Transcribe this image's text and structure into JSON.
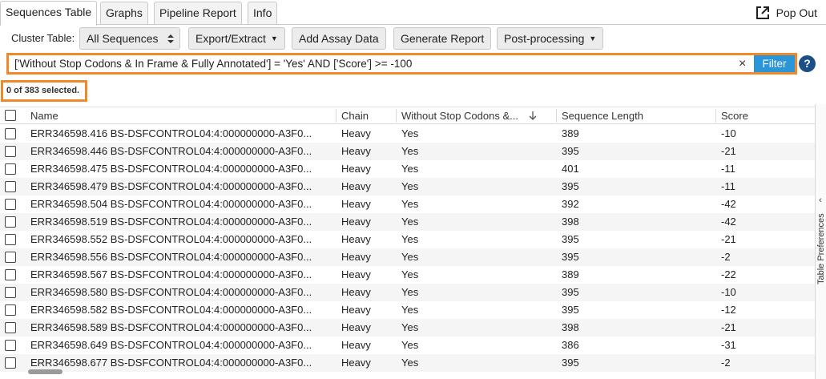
{
  "tabs": [
    {
      "label": "Sequences Table",
      "active": true
    },
    {
      "label": "Graphs",
      "active": false
    },
    {
      "label": "Pipeline Report",
      "active": false
    },
    {
      "label": "Info",
      "active": false
    }
  ],
  "popout": {
    "label": "Pop Out",
    "icon": "external-link-icon"
  },
  "toolbar": {
    "cluster_table_label": "Cluster Table:",
    "cluster_table_value": "All Sequences",
    "export_label": "Export/Extract",
    "add_assay_label": "Add Assay Data",
    "generate_report_label": "Generate Report",
    "post_processing_label": "Post-processing"
  },
  "filter": {
    "query": "['Without Stop Codons & In Frame & Fully Annotated'] = 'Yes' AND ['Score'] >= -100",
    "clear_icon": "×",
    "button_label": "Filter",
    "help_icon": "?"
  },
  "selection": {
    "text": "0 of 383 selected."
  },
  "colors": {
    "accent_blue": "#2a95d8",
    "highlight_orange": "#f0892c",
    "help_navy": "#1c4f86"
  },
  "table": {
    "columns": [
      "Name",
      "Chain",
      "Without Stop Codons &...",
      "Sequence Length",
      "Score"
    ],
    "sorted_column": "Without Stop Codons &...",
    "sort_direction": "descending",
    "rows": [
      {
        "name": "ERR346598.416 BS-DSFCONTROL04:4:000000000-A3F0...",
        "chain": "Heavy",
        "wsc": "Yes",
        "length": "389",
        "score": "-10"
      },
      {
        "name": "ERR346598.446 BS-DSFCONTROL04:4:000000000-A3F0...",
        "chain": "Heavy",
        "wsc": "Yes",
        "length": "395",
        "score": "-21"
      },
      {
        "name": "ERR346598.475 BS-DSFCONTROL04:4:000000000-A3F0...",
        "chain": "Heavy",
        "wsc": "Yes",
        "length": "401",
        "score": "-11"
      },
      {
        "name": "ERR346598.479 BS-DSFCONTROL04:4:000000000-A3F0...",
        "chain": "Heavy",
        "wsc": "Yes",
        "length": "395",
        "score": "-11"
      },
      {
        "name": "ERR346598.504 BS-DSFCONTROL04:4:000000000-A3F0...",
        "chain": "Heavy",
        "wsc": "Yes",
        "length": "392",
        "score": "-42"
      },
      {
        "name": "ERR346598.519 BS-DSFCONTROL04:4:000000000-A3F0...",
        "chain": "Heavy",
        "wsc": "Yes",
        "length": "398",
        "score": "-42"
      },
      {
        "name": "ERR346598.552 BS-DSFCONTROL04:4:000000000-A3F0...",
        "chain": "Heavy",
        "wsc": "Yes",
        "length": "395",
        "score": "-21"
      },
      {
        "name": "ERR346598.556 BS-DSFCONTROL04:4:000000000-A3F0...",
        "chain": "Heavy",
        "wsc": "Yes",
        "length": "395",
        "score": "-2"
      },
      {
        "name": "ERR346598.567 BS-DSFCONTROL04:4:000000000-A3F0...",
        "chain": "Heavy",
        "wsc": "Yes",
        "length": "389",
        "score": "-22"
      },
      {
        "name": "ERR346598.580 BS-DSFCONTROL04:4:000000000-A3F0...",
        "chain": "Heavy",
        "wsc": "Yes",
        "length": "395",
        "score": "-10"
      },
      {
        "name": "ERR346598.582 BS-DSFCONTROL04:4:000000000-A3F0...",
        "chain": "Heavy",
        "wsc": "Yes",
        "length": "395",
        "score": "-12"
      },
      {
        "name": "ERR346598.589 BS-DSFCONTROL04:4:000000000-A3F0...",
        "chain": "Heavy",
        "wsc": "Yes",
        "length": "398",
        "score": "-21"
      },
      {
        "name": "ERR346598.649 BS-DSFCONTROL04:4:000000000-A3F0...",
        "chain": "Heavy",
        "wsc": "Yes",
        "length": "386",
        "score": "-31"
      },
      {
        "name": "ERR346598.677 BS-DSFCONTROL04:4:000000000-A3F0...",
        "chain": "Heavy",
        "wsc": "Yes",
        "length": "395",
        "score": "-2"
      }
    ]
  },
  "side_panel": {
    "label": "Table Preferences",
    "chevron": "‹"
  }
}
